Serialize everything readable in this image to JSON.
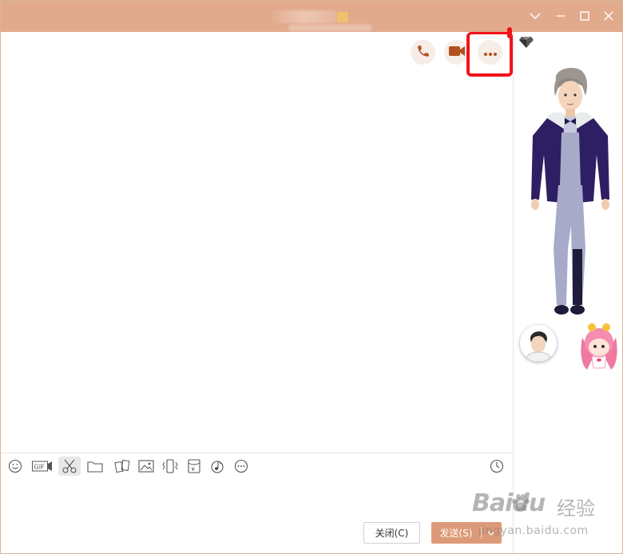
{
  "buttons": {
    "close_label": "关闭(C)",
    "send_label": "发送(S)"
  },
  "watermark": {
    "brand": "Baidu",
    "brand_cn": "经验",
    "url": "jingyan.baidu.com"
  },
  "colors": {
    "titlebar": "#e2aa8c",
    "accent": "#dd9a78",
    "annotation": "#f2131a",
    "icon_brown": "#b2501f"
  },
  "icons": {
    "window_controls": [
      "chevron-down-icon",
      "minimize-icon",
      "maximize-icon",
      "close-icon"
    ],
    "call_actions": [
      "phone-icon",
      "video-camera-icon",
      "more-icon"
    ],
    "toolbar": [
      "emoji-icon",
      "gif-icon",
      "scissors-icon",
      "folder-icon",
      "sticker-icon",
      "image-icon",
      "vibrate-icon",
      "red-packet-icon",
      "music-icon",
      "more-circle-icon",
      "history-clock-icon"
    ]
  }
}
